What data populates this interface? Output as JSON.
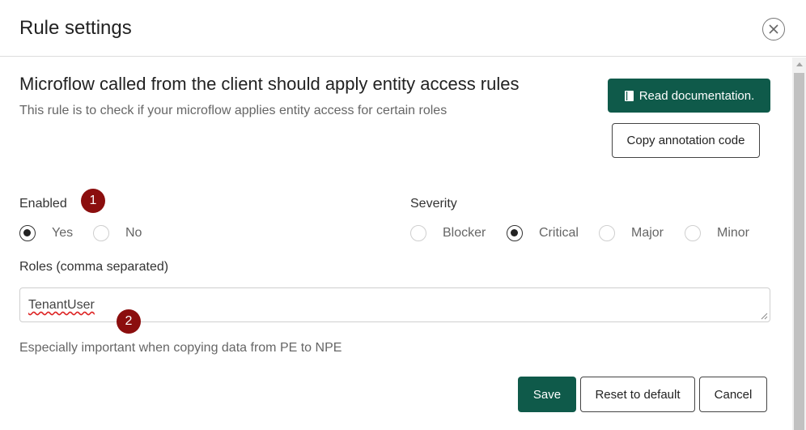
{
  "dialog": {
    "title": "Rule settings"
  },
  "rule": {
    "title": "Microflow called from the client should apply entity access rules",
    "description": "This rule is to check if your microflow applies entity access for certain roles"
  },
  "actions": {
    "read_docs_label": "Read documentation.",
    "copy_annotation_label": "Copy annotation code"
  },
  "enabled": {
    "label": "Enabled",
    "options": [
      "Yes",
      "No"
    ],
    "selected": "Yes"
  },
  "severity": {
    "label": "Severity",
    "options": [
      "Blocker",
      "Critical",
      "Major",
      "Minor"
    ],
    "selected": "Critical"
  },
  "roles": {
    "label": "Roles (comma separated)",
    "value": "TenantUser"
  },
  "hint": "Especially important when copying data from PE to NPE",
  "badges": [
    "1",
    "2"
  ],
  "footer": {
    "save_label": "Save",
    "reset_label": "Reset to default",
    "cancel_label": "Cancel"
  },
  "colors": {
    "primary": "#0f5a4a",
    "badge": "#8b0e0e"
  },
  "icons": {
    "close": "close-icon",
    "book": "book-icon"
  }
}
